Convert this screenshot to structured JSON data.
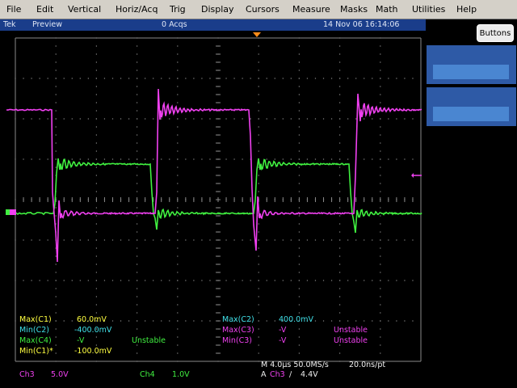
{
  "menu": [
    "File",
    "Edit",
    "Vertical",
    "Horiz/Acq",
    "Trig",
    "Display",
    "Cursors",
    "Measure",
    "Masks",
    "Math",
    "Utilities",
    "Help"
  ],
  "status": {
    "brand": "Tek",
    "mode": "Preview",
    "acqs": "0 Acqs",
    "datetime": "14 Nov 06 16:14:06"
  },
  "buttons_label": "Buttons",
  "measurements": {
    "left": [
      {
        "label": "Max(C1)",
        "value": "60.0mV",
        "status": "",
        "color": "yellow"
      },
      {
        "label": "Min(C2)",
        "value": "-400.0mV",
        "status": "",
        "color": "cyan"
      },
      {
        "label": "Max(C4)",
        "value": "-V",
        "status": "Unstable",
        "color": "green"
      },
      {
        "label": "Min(C1)*",
        "value": "-100.0mV",
        "status": "",
        "color": "yellow"
      }
    ],
    "right": [
      {
        "label": "Max(C2)",
        "value": "400.0mV",
        "status": "",
        "color": "cyan"
      },
      {
        "label": "Max(C3)",
        "value": "-V",
        "status": "Unstable",
        "color": "magenta"
      },
      {
        "label": "Min(C3)",
        "value": "-V",
        "status": "Unstable",
        "color": "magenta"
      }
    ]
  },
  "channels": {
    "ch3": {
      "label": "Ch3",
      "scale": "5.0V"
    },
    "ch4": {
      "label": "Ch4",
      "scale": "1.0V"
    }
  },
  "horizontal": {
    "timebase": "M 4.0µs 50.0MS/s",
    "resolution": "20.0ns/pt",
    "trigger_prefix": "A",
    "trigger_source": "Ch3",
    "trigger_slope": "∕",
    "trigger_level": "4.4V"
  },
  "colors": {
    "ch3": "#f040f0",
    "ch4": "#40f040",
    "grid": "#8a8a8a",
    "trigger_marker": "#ff8c1a"
  }
}
